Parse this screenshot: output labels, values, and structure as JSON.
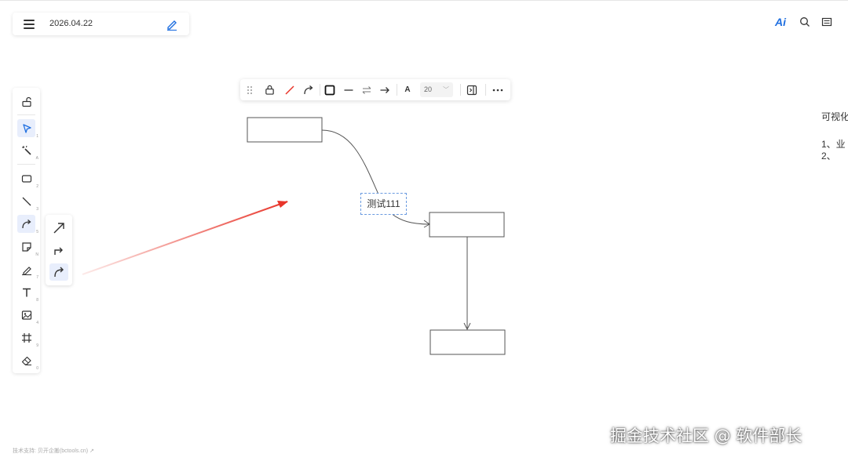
{
  "header": {
    "date": "2026.04.22"
  },
  "top_right": {
    "ai_label": "Ai"
  },
  "float_toolbar": {
    "font_size": "20",
    "font_label": "A"
  },
  "canvas": {
    "label": "测试111",
    "side_text": {
      "line1": "可视化",
      "line2": "1、业",
      "line3": "2、"
    }
  },
  "footer": {
    "text": "技术支持: 贝开企搬(bctools.cn) ↗"
  },
  "watermark": "掘金技术社区 @ 软件部长",
  "colors": {
    "accent": "#1f6fe0",
    "arrow_red": "#e8352a",
    "shape_stroke": "#555555"
  }
}
